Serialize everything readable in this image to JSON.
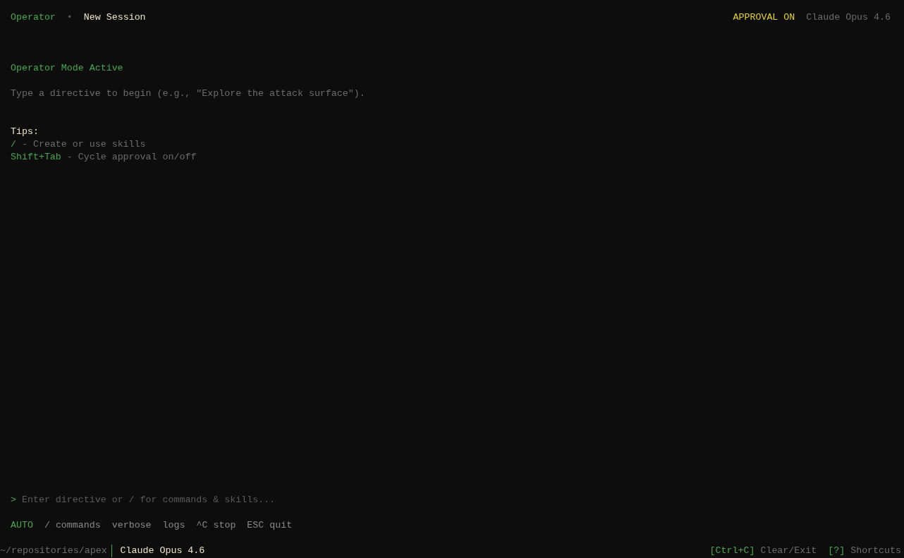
{
  "header": {
    "app": "Operator",
    "separator": "•",
    "session": "New Session",
    "approval": {
      "label": "APPROVAL ON",
      "on": true
    },
    "model": "Claude Opus 4.6"
  },
  "intro": {
    "title": "Operator Mode Active",
    "hint": "Type a directive to begin (e.g., \"Explore the attack surface\")."
  },
  "tips": {
    "heading": "Tips:",
    "items": [
      {
        "key": "/",
        "desc": "- Create or use skills"
      },
      {
        "key": "Shift+Tab",
        "desc": "- Cycle approval on/off"
      }
    ]
  },
  "input": {
    "prompt": ">",
    "placeholder": "Enter directive or / for commands & skills..."
  },
  "hints": [
    {
      "label": "AUTO",
      "kind": "mode"
    },
    {
      "label": "/ commands",
      "kind": "plain"
    },
    {
      "label": "verbose",
      "kind": "plain"
    },
    {
      "label": "logs",
      "kind": "plain"
    },
    {
      "label": "^C stop",
      "kind": "plain"
    },
    {
      "label": "ESC quit",
      "kind": "plain"
    }
  ],
  "status_bar": {
    "path": "~/repositories/apex",
    "model": "Claude Opus 4.6",
    "shortcuts": [
      {
        "key": "[Ctrl+C]",
        "label": "Clear/Exit"
      },
      {
        "key": "[?]",
        "label": "Shortcuts"
      }
    ]
  }
}
